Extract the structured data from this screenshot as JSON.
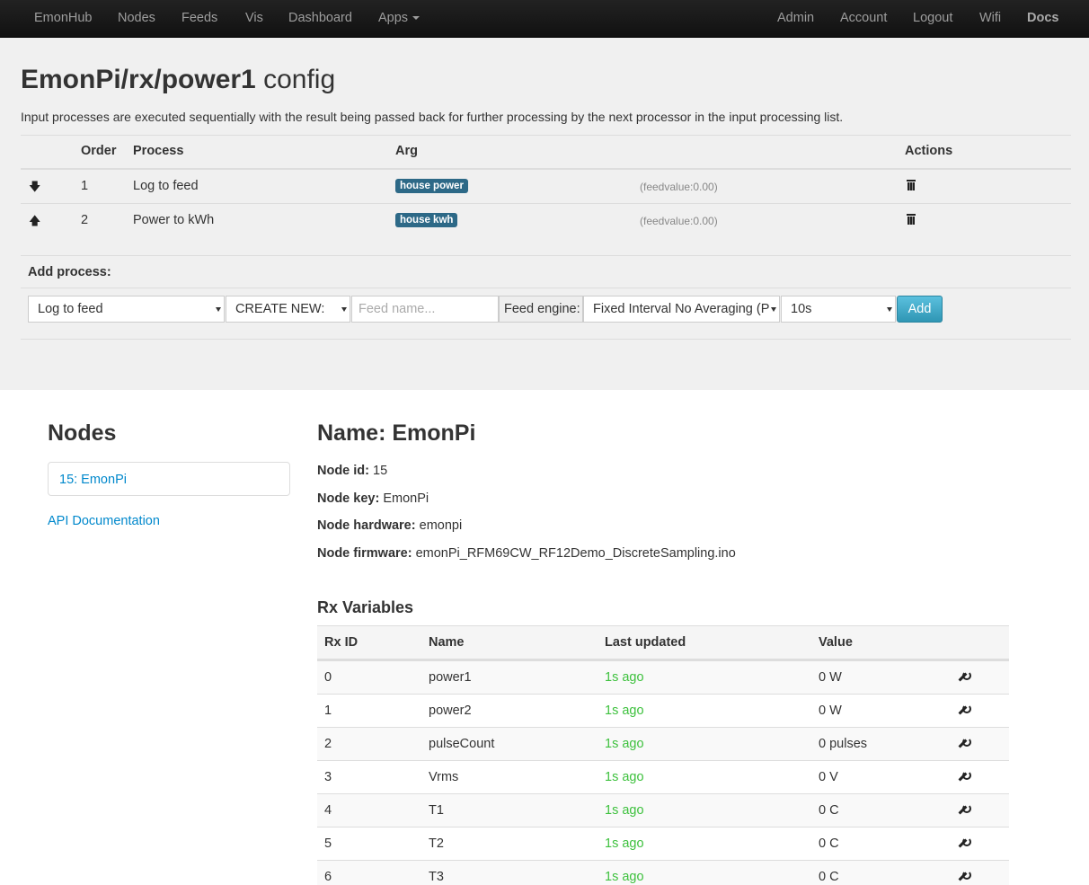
{
  "nav": {
    "left": [
      "EmonHub",
      "Nodes",
      "Feeds",
      "Vis",
      "Dashboard",
      "Apps"
    ],
    "right": [
      "Admin",
      "Account",
      "Logout",
      "Wifi",
      "Docs"
    ]
  },
  "config": {
    "title_bold": "EmonPi/rx/power1",
    "title_rest": "config",
    "description": "Input processes are executed sequentially with the result being passed back for further processing by the next processor in the input processing list.",
    "headers": {
      "order": "Order",
      "process": "Process",
      "arg": "Arg",
      "actions": "Actions"
    },
    "processes": [
      {
        "order": "1",
        "process": "Log to feed",
        "arg": "house power",
        "feedvalue": "(feedvalue:0.00)",
        "move_icon": "arrow-down-icon"
      },
      {
        "order": "2",
        "process": "Power to kWh",
        "arg": "house kwh",
        "feedvalue": "(feedvalue:0.00)",
        "move_icon": "arrow-up-icon"
      }
    ],
    "add_process_label": "Add process:",
    "add_form": {
      "process_select": "Log to feed",
      "create_select": "CREATE NEW:",
      "feed_name_placeholder": "Feed name...",
      "engine_label": "Feed engine:",
      "engine_select": "Fixed Interval No Averaging (P",
      "interval_select": "10s",
      "add_button": "Add"
    }
  },
  "sidebar": {
    "title": "Nodes",
    "node_item": "15: EmonPi",
    "api_link": "API Documentation"
  },
  "node": {
    "title": "Name: EmonPi",
    "fields": [
      {
        "label": "Node id:",
        "value": "15"
      },
      {
        "label": "Node key:",
        "value": "EmonPi"
      },
      {
        "label": "Node hardware:",
        "value": "emonpi"
      },
      {
        "label": "Node firmware:",
        "value": "emonPi_RFM69CW_RF12Demo_DiscreteSampling.ino"
      }
    ],
    "rx_title": "Rx Variables",
    "rx_headers": [
      "Rx ID",
      "Name",
      "Last updated",
      "Value"
    ],
    "rx_rows": [
      {
        "id": "0",
        "name": "power1",
        "updated": "1s ago",
        "value": "0 W"
      },
      {
        "id": "1",
        "name": "power2",
        "updated": "1s ago",
        "value": "0 W"
      },
      {
        "id": "2",
        "name": "pulseCount",
        "updated": "1s ago",
        "value": "0 pulses"
      },
      {
        "id": "3",
        "name": "Vrms",
        "updated": "1s ago",
        "value": "0 V"
      },
      {
        "id": "4",
        "name": "T1",
        "updated": "1s ago",
        "value": "0 C"
      },
      {
        "id": "5",
        "name": "T2",
        "updated": "1s ago",
        "value": "0 C"
      },
      {
        "id": "6",
        "name": "T3",
        "updated": "1s ago",
        "value": "0 C"
      }
    ]
  },
  "colors": {
    "navbar": "#1b1b1b",
    "panel": "#f0f0f0",
    "badge": "#2d6987",
    "link": "#0088cc",
    "recent": "#3ec13e",
    "add_button": "#49afcd"
  }
}
